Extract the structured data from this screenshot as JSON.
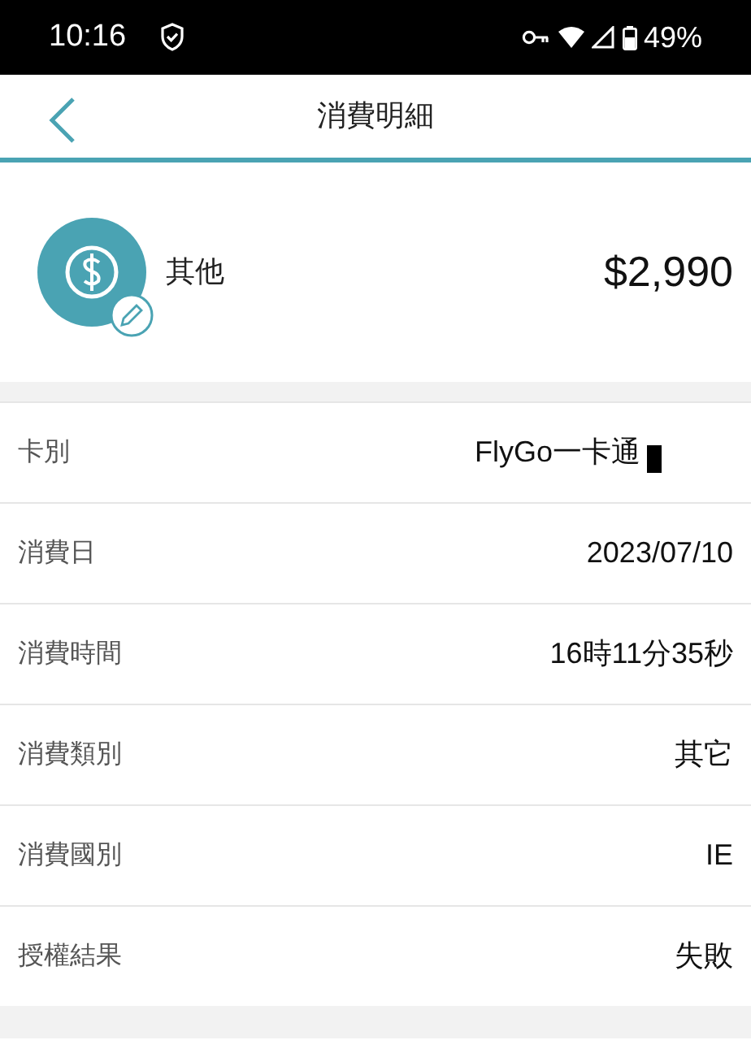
{
  "status_bar": {
    "time": "10:16",
    "battery": "49%"
  },
  "header": {
    "title": "消費明細"
  },
  "summary": {
    "category": "其他",
    "amount": "$2,990"
  },
  "details": [
    {
      "label": "卡別",
      "value": "FlyGo一卡通",
      "redacted": true
    },
    {
      "label": "消費日",
      "value": "2023/07/10",
      "redacted": false
    },
    {
      "label": "消費時間",
      "value": "16時11分35秒",
      "redacted": false
    },
    {
      "label": "消費類別",
      "value": "其它",
      "redacted": false
    },
    {
      "label": "消費國別",
      "value": "IE",
      "redacted": false
    },
    {
      "label": "授權結果",
      "value": "失敗",
      "redacted": false
    }
  ]
}
